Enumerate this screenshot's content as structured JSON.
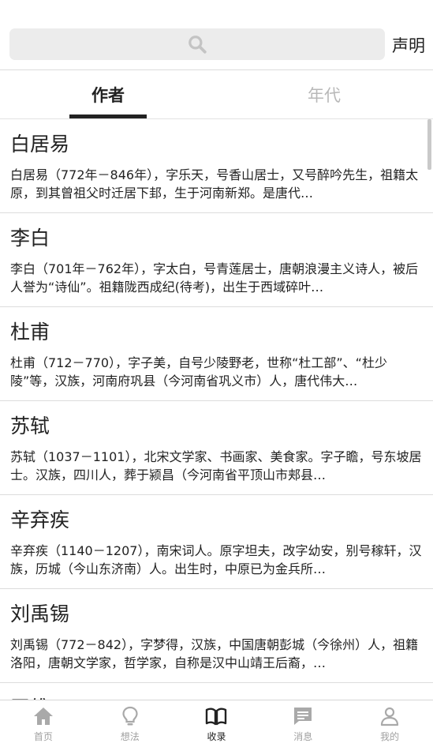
{
  "search": {
    "declare_label": "声明"
  },
  "tabs": [
    {
      "label": "作者",
      "active": true
    },
    {
      "label": "年代",
      "active": false
    }
  ],
  "authors": [
    {
      "name": "白居易",
      "desc": "白居易（772年－846年），字乐天，号香山居士，又号醉吟先生，祖籍太原，到其曾祖父时迁居下邽，生于河南新郑。是唐代…"
    },
    {
      "name": "李白",
      "desc": "李白（701年－762年），字太白，号青莲居士，唐朝浪漫主义诗人，被后人誉为“诗仙”。祖籍陇西成纪(待考)，出生于西域碎叶…"
    },
    {
      "name": "杜甫",
      "desc": "杜甫（712－770），字子美，自号少陵野老，世称“杜工部”、“杜少陵”等，汉族，河南府巩县（今河南省巩义市）人，唐代伟大…"
    },
    {
      "name": "苏轼",
      "desc": "苏轼（1037－1101），北宋文学家、书画家、美食家。字子瞻，号东坡居士。汉族，四川人，葬于颍昌（今河南省平顶山市郏县…"
    },
    {
      "name": "辛弃疾",
      "desc": "辛弃疾（1140－1207），南宋词人。原字坦夫，改字幼安，别号稼轩，汉族，历城（今山东济南）人。出生时，中原已为金兵所…"
    },
    {
      "name": "刘禹锡",
      "desc": "刘禹锡（772－842），字梦得，汉族，中国唐朝彭城（今徐州）人，祖籍洛阳，唐朝文学家，哲学家，自称是汉中山靖王后裔，…"
    },
    {
      "name": "王维",
      "desc": ""
    }
  ],
  "nav": [
    {
      "label": "首页",
      "icon": "home-icon",
      "active": false
    },
    {
      "label": "想法",
      "icon": "lightbulb-icon",
      "active": false
    },
    {
      "label": "收录",
      "icon": "book-icon",
      "active": true
    },
    {
      "label": "消息",
      "icon": "message-icon",
      "active": false
    },
    {
      "label": "我的",
      "icon": "user-icon",
      "active": false
    }
  ],
  "colors": {
    "active": "#222222",
    "inactive": "#b8b8b8",
    "nav_inactive": "#a0a0a0"
  }
}
